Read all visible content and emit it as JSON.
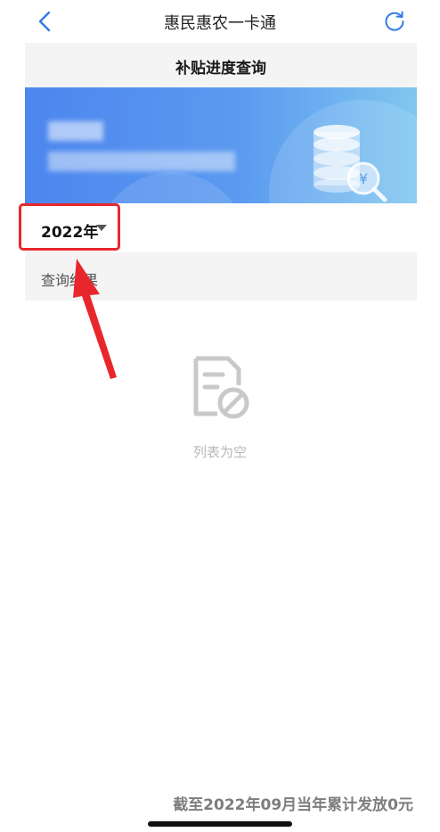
{
  "navbar": {
    "title": "惠民惠农一卡通",
    "back_icon": "chevron-left-icon",
    "refresh_icon": "refresh-icon",
    "accent_color": "#2f7de1"
  },
  "page": {
    "title": "补贴进度查询"
  },
  "filter": {
    "year_label": "2022年",
    "caret_icon": "caret-down-icon",
    "highlight_color": "#e8272d"
  },
  "results": {
    "label": "查询结果",
    "empty_icon": "empty-document-icon",
    "empty_text": "列表为空"
  },
  "footer": {
    "note": "截至2022年09月当年累计发放0元"
  }
}
